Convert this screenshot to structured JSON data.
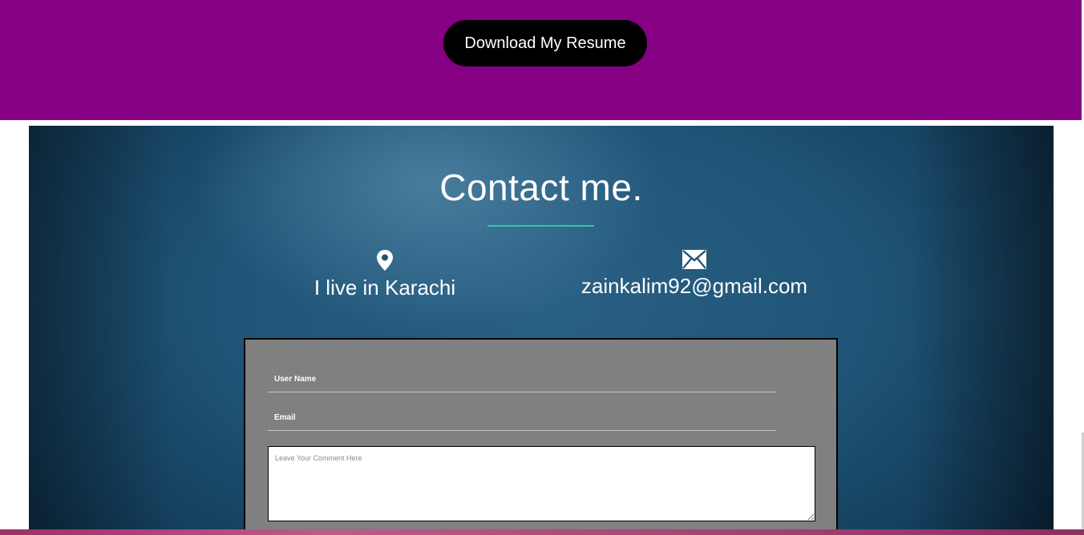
{
  "resume": {
    "button_label": "Download My Resume",
    "background_color": "#850082"
  },
  "contact": {
    "title": "Contact me.",
    "accent_color": "#1fd1a3",
    "location": {
      "icon": "map-pin-icon",
      "prefix": "I live in ",
      "city": "Karachi"
    },
    "email": {
      "icon": "envelope-icon",
      "address": "zainkalim92@gmail.com"
    }
  },
  "form": {
    "username_placeholder": "User Name",
    "email_placeholder": "Email",
    "comment_placeholder": "Leave Your Comment Here"
  }
}
